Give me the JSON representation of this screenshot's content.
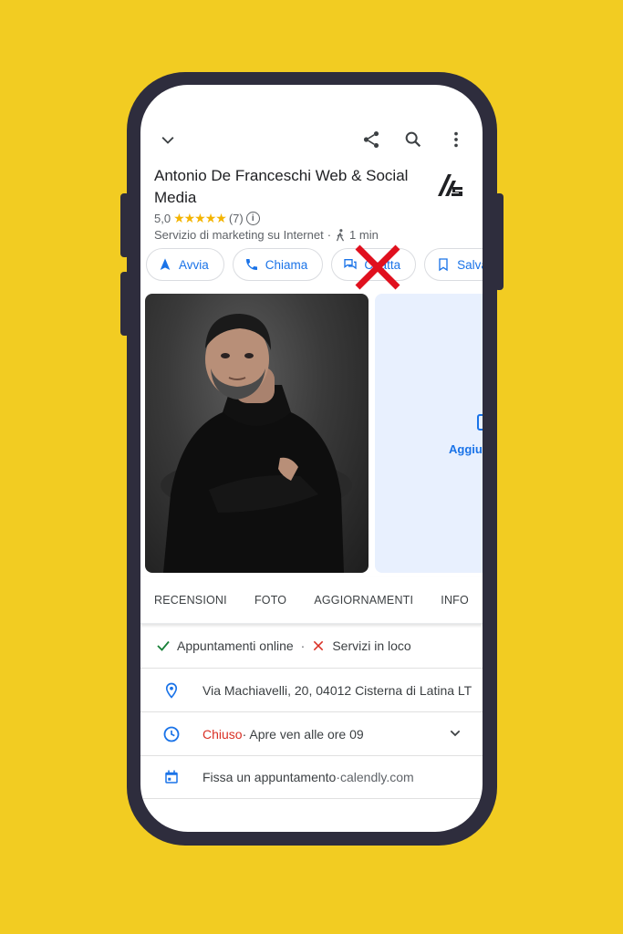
{
  "header": {
    "icons": [
      "chevron-down-icon",
      "share-icon",
      "search-icon",
      "more-vert-icon"
    ]
  },
  "place": {
    "name": "Antonio De Franceschi Web & Social Media",
    "rating": "5,0",
    "stars": "★★★★★",
    "review_count": "(7)",
    "category": "Servizio di marketing su Internet",
    "separator": "·",
    "walk_time": "1 min"
  },
  "actions": [
    {
      "label": "Avvia",
      "icon": "navigate-icon"
    },
    {
      "label": "Chiama",
      "icon": "phone-icon"
    },
    {
      "label": "Chatta",
      "icon": "chat-icon"
    },
    {
      "label": "Salva",
      "icon": "bookmark-icon"
    }
  ],
  "photos": {
    "add_label": "Aggiu"
  },
  "tabs": [
    "RECENSIONI",
    "FOTO",
    "AGGIORNAMENTI",
    "INFO"
  ],
  "features": {
    "online": "Appuntamenti online",
    "separator": "·",
    "onsite": "Servizi in loco"
  },
  "address": "Via Machiavelli, 20, 04012 Cisterna di Latina LT",
  "hours": {
    "status": "Chiuso",
    "detail": " · Apre ven alle ore 09"
  },
  "booking": {
    "label": "Fissa un appuntamento",
    "separator": " · ",
    "link": "calendly.com"
  },
  "colors": {
    "background": "#F2CC22",
    "phone": "#2E2D3D",
    "accent": "#1a73e8",
    "closed": "#d93025",
    "check": "#188038",
    "star": "#F4B400",
    "cross": "#E0101E"
  }
}
